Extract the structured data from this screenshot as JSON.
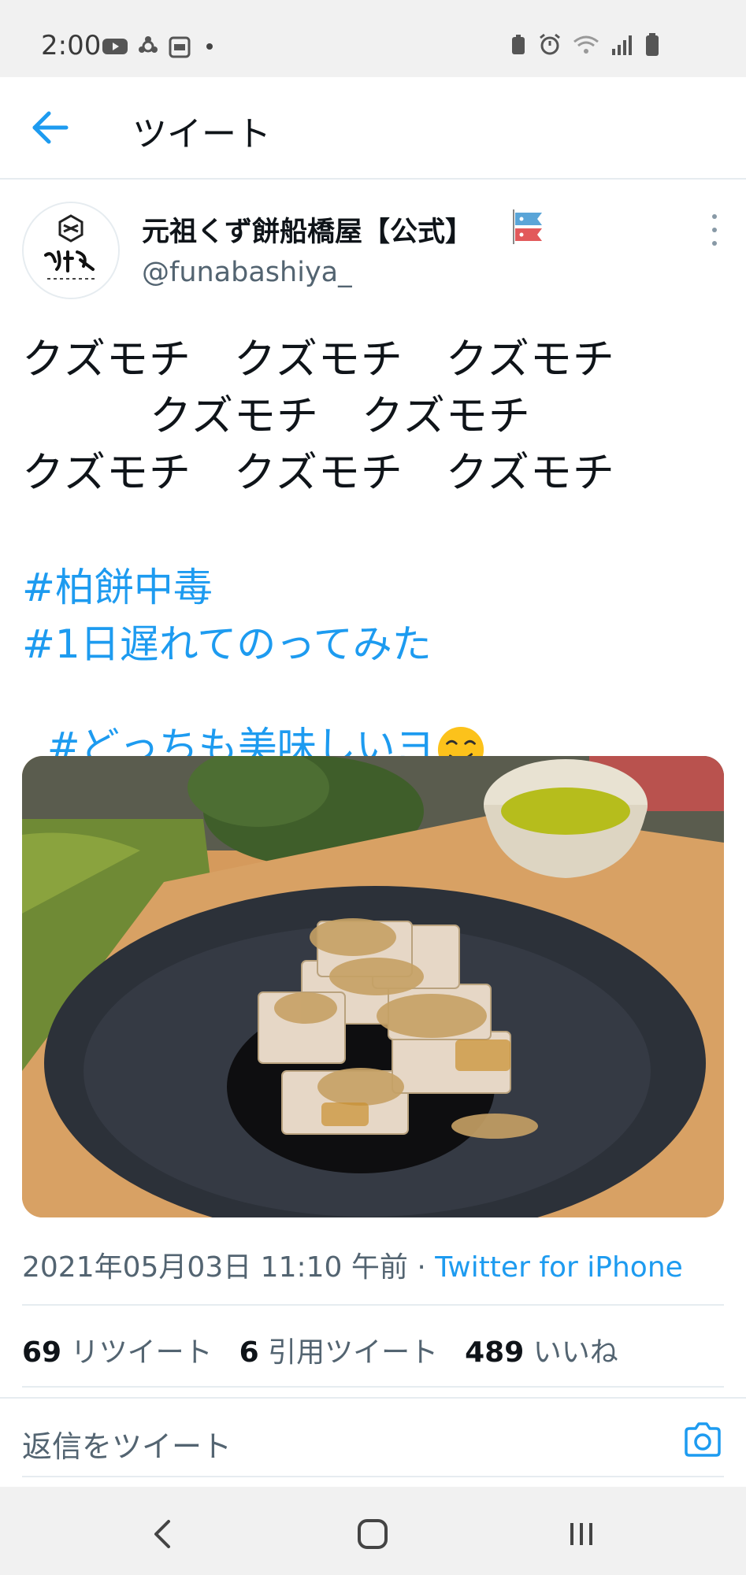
{
  "status_bar": {
    "time": "2:00"
  },
  "header": {
    "title": "ツイート"
  },
  "tweet": {
    "author": {
      "display_name": "元祖くず餅船橋屋【公式】",
      "handle": "@funabashiya_"
    },
    "text_lines": [
      "クズモチ　クズモチ　クズモチ",
      "　　　クズモチ　クズモチ",
      "クズモチ　クズモチ　クズモチ"
    ],
    "hashtags": [
      "#柏餅中毒",
      "#1日遅れてのってみた",
      "#どっちも美味しいヨ"
    ],
    "photo_alt": "くず餅",
    "timestamp": "2021年05月03日 11:10 午前",
    "separator": " · ",
    "source": "Twitter for iPhone",
    "stats": {
      "retweets": {
        "count": "69",
        "label": "リツイート"
      },
      "quotes": {
        "count": "6",
        "label": "引用ツイート"
      },
      "likes": {
        "count": "489",
        "label": "いいね"
      }
    }
  },
  "reply": {
    "placeholder": "返信をツイート"
  },
  "icons": {
    "back": "arrow-left-icon",
    "more": "more-vertical-icon",
    "camera": "camera-icon",
    "emoji": "drooling-face-emoji",
    "flag": "koinobori-flag-emoji"
  },
  "colors": {
    "accent": "#1d9bf0",
    "text": "#0f1419",
    "secondary": "#536471"
  }
}
